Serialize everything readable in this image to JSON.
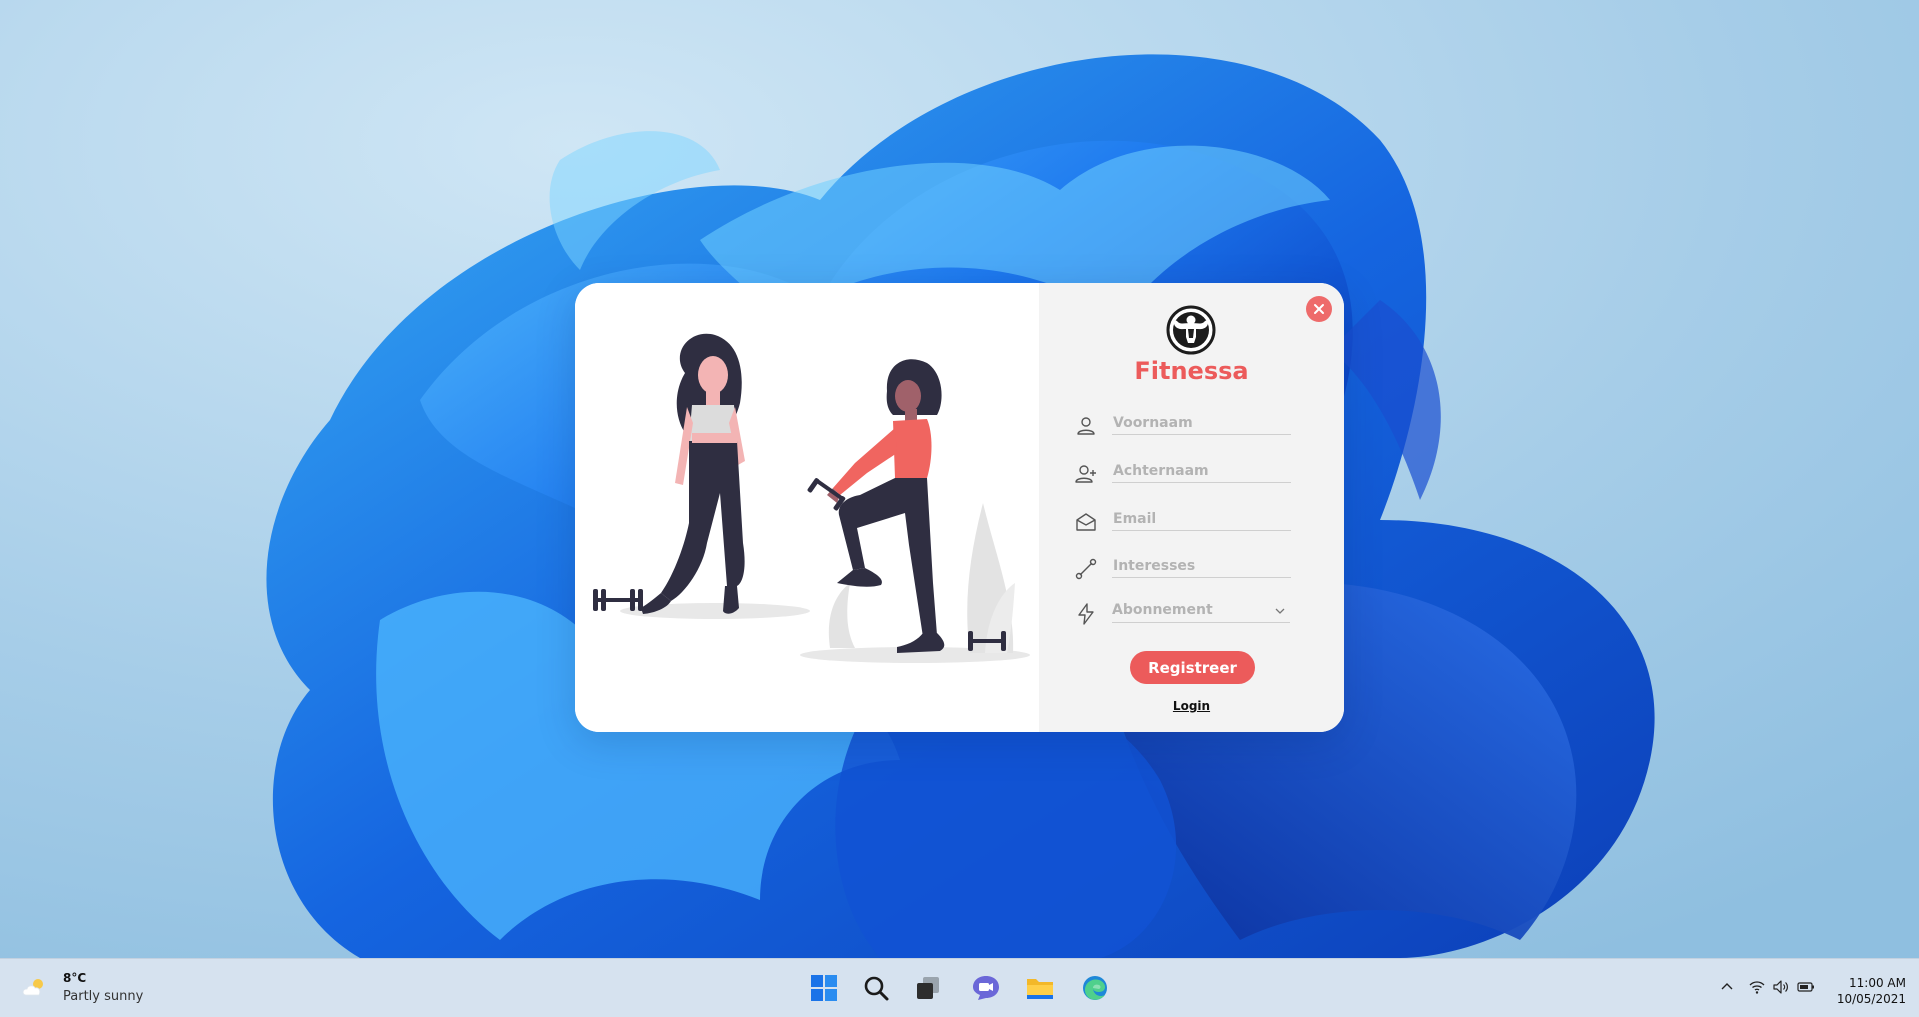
{
  "desktop": {
    "wallpaper": "windows-11-bloom"
  },
  "dialog": {
    "brand": "Fitnessa",
    "logo_icon": "bodybuilder-logo-icon",
    "close_icon": "close-icon",
    "fields": [
      {
        "placeholder": "Voornaam",
        "icon": "user-icon"
      },
      {
        "placeholder": "Achternaam",
        "icon": "user-plus-icon"
      },
      {
        "placeholder": "Email",
        "icon": "envelope-icon"
      },
      {
        "placeholder": "Interesses",
        "icon": "dumbbell-icon"
      }
    ],
    "subscription": {
      "selected": "Abonnement",
      "icon": "lightning-icon"
    },
    "register_label": "Registreer",
    "login_label": "Login",
    "colors": {
      "accent": "#ec5b5b",
      "form_bg": "#f3f3f3"
    }
  },
  "taskbar": {
    "weather": {
      "temp": "8°C",
      "condition": "Partly sunny",
      "icon": "partly-sunny-icon"
    },
    "apps": [
      {
        "name": "start-icon"
      },
      {
        "name": "search-icon"
      },
      {
        "name": "task-view-icon"
      },
      {
        "name": "chat-icon"
      },
      {
        "name": "file-explorer-icon"
      },
      {
        "name": "edge-icon"
      }
    ],
    "tray": [
      "chevron-up-icon",
      "wifi-icon",
      "volume-icon",
      "battery-icon"
    ],
    "clock": {
      "time": "11:00 AM",
      "date": "10/05/2021"
    }
  }
}
